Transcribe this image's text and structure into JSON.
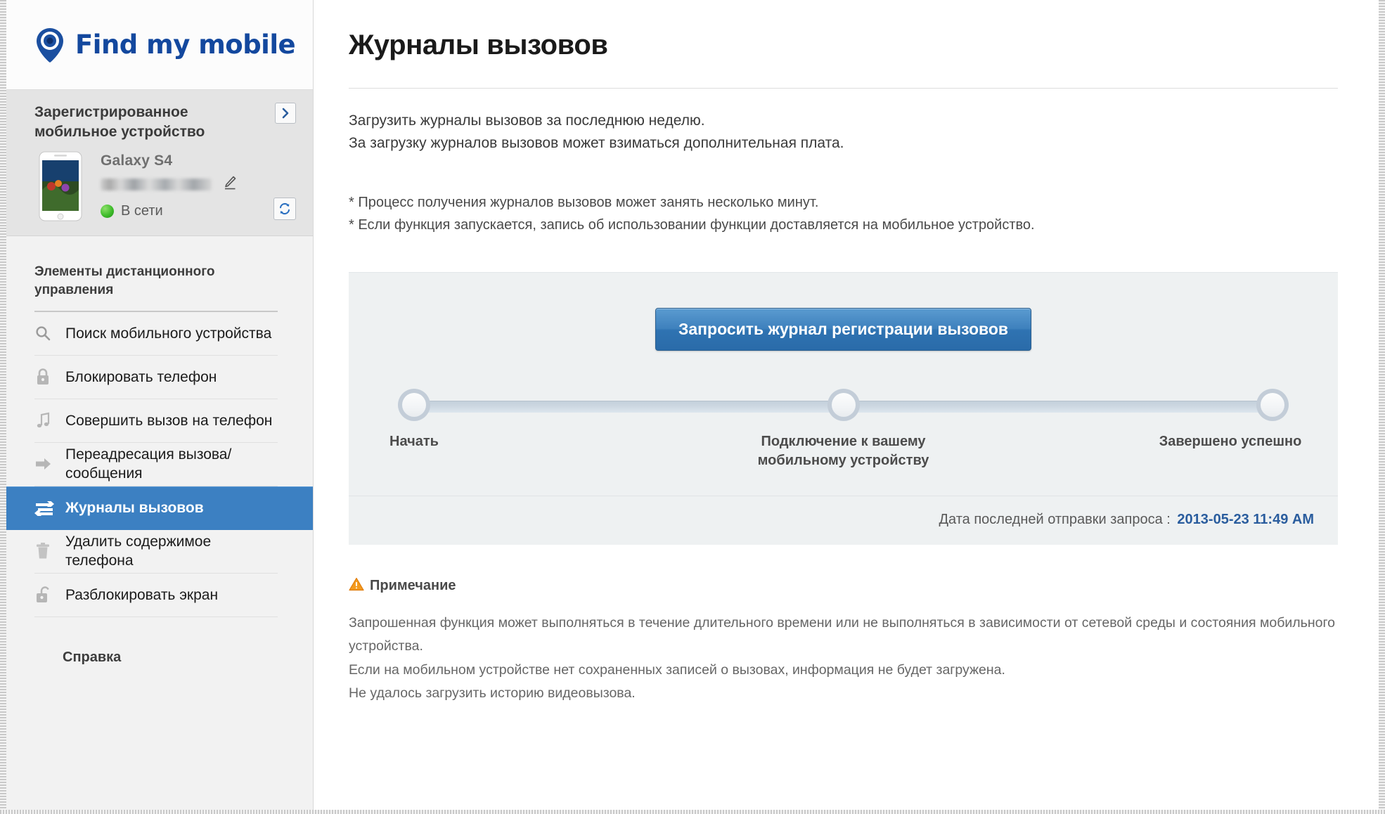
{
  "brand": {
    "name": "Find my mobile",
    "pin_icon": "location-pin-icon"
  },
  "sidebar": {
    "registered_device_title": "Зарегистрированное мобильное устройство",
    "expand_icon": "chevron-right-icon",
    "device": {
      "name": "Galaxy S4",
      "number_redacted": "",
      "edit_icon": "pencil-edit-icon",
      "status_text": "В сети",
      "status_color": "#3fbc2b",
      "refresh_icon": "refresh-icon",
      "image_icon": "smartphone-image"
    },
    "menu_title": "Элементы дистанционного управления",
    "items": [
      {
        "label": "Поиск мобильного устройства",
        "icon": "search-icon",
        "active": false
      },
      {
        "label": "Блокировать телефон",
        "icon": "lock-icon",
        "active": false
      },
      {
        "label": "Совершить вызов на телефон",
        "icon": "music-note-icon",
        "active": false
      },
      {
        "label": "Переадресация вызова/ сообщения",
        "icon": "arrow-right-icon",
        "active": false
      },
      {
        "label": "Журналы вызовов",
        "icon": "call-logs-icon",
        "active": true
      },
      {
        "label": "Удалить содержимое телефона",
        "icon": "trash-icon",
        "active": false
      },
      {
        "label": "Разблокировать экран",
        "icon": "unlock-icon",
        "active": false
      }
    ],
    "help_label": "Справка",
    "active_color": "#3c80c2"
  },
  "main": {
    "title": "Журналы вызовов",
    "intro_line1": "Загрузить журналы вызовов за последнюю неделю.",
    "intro_line2": "За загрузку журналов вызовов может взиматься дополнительная плата.",
    "note_line1": "* Процесс получения журналов вызовов может занять несколько минут.",
    "note_line2": "* Если функция запускается, запись об использовании функции доставляется на мобильное устройство.",
    "request_button": "Запросить журнал регистрации вызовов",
    "steps": [
      {
        "label": "Начать"
      },
      {
        "label": "Подключение к вашему мобильному устройству"
      },
      {
        "label": "Завершено успешно"
      }
    ],
    "last_request_label": "Дата последней отправки запроса :",
    "last_request_date": "2013-05-23 11:49 AM",
    "notice": {
      "icon": "warning-triangle-icon",
      "title": "Примечание",
      "line1": "Запрошенная функция может выполняться в течение длительного времени или не выполняться в зависимости от сетевой среды и состояния мобильного устройства.",
      "line2": "Если на мобильном устройстве нет сохраненных записей о вызовах, информация не будет загружена.",
      "line3": "Не удалось загрузить историю видеовызова."
    }
  }
}
